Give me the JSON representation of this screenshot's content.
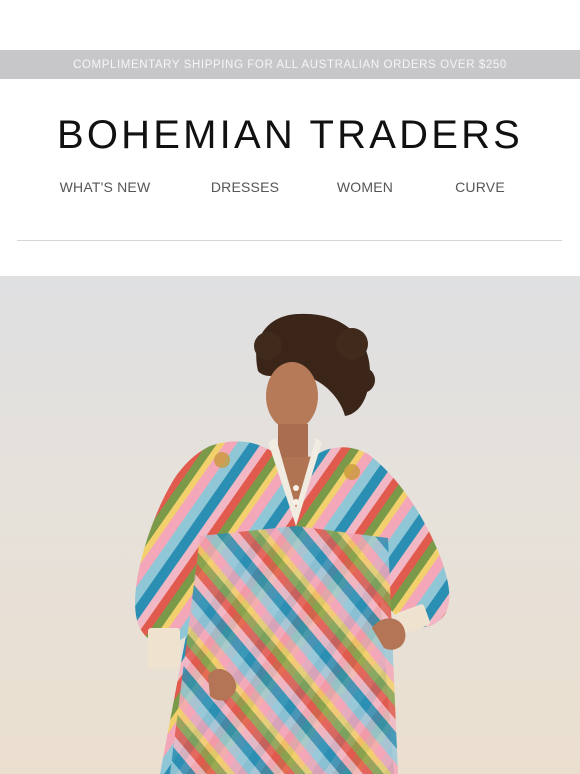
{
  "promo": {
    "text": "COMPLIMENTARY SHIPPING FOR ALL AUSTRALIAN ORDERS OVER $250"
  },
  "brand": {
    "name": "BOHEMIAN TRADERS"
  },
  "nav": {
    "items": [
      {
        "label": "WHAT'S NEW"
      },
      {
        "label": "DRESSES"
      },
      {
        "label": "WOMEN"
      },
      {
        "label": "CURVE"
      }
    ]
  },
  "colors": {
    "promo_bg": "#c7c7c9",
    "text_dark": "#111111",
    "nav_text": "#555555"
  },
  "hero": {
    "image": "model-in-striped-dress-photo"
  }
}
